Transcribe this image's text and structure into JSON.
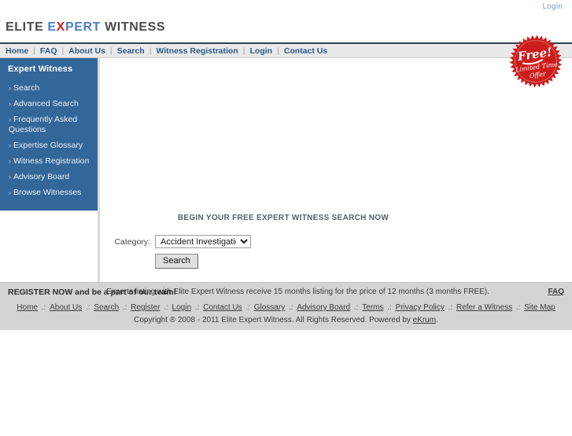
{
  "topbar": {
    "login_label": "Login"
  },
  "logo": {
    "part1": "ELITE ",
    "part2_e": "E",
    "part2_x": "X",
    "part2_pert": "PERT",
    "part3": " WITNESS"
  },
  "badge": {
    "title": "Free!",
    "line1": "Limited Time",
    "line2": "Offer",
    "color": "#cc1d1d"
  },
  "nav": {
    "items": [
      {
        "label": "Home"
      },
      {
        "label": "FAQ"
      },
      {
        "label": "About Us"
      },
      {
        "label": "Search"
      },
      {
        "label": "Witness Registration"
      },
      {
        "label": "Login"
      },
      {
        "label": "Contact Us"
      }
    ],
    "separator": "|"
  },
  "sidebar": {
    "title": "Expert Witness",
    "arrow": "›",
    "background": "#336699",
    "items": [
      {
        "label": "Search"
      },
      {
        "label": "Advanced Search"
      },
      {
        "label": "Frequently Asked Questions"
      },
      {
        "label": "Expertise Glossary"
      },
      {
        "label": "Witness Registration"
      },
      {
        "label": "Advisory Board"
      },
      {
        "label": "Browse Witnesses"
      }
    ]
  },
  "search_form": {
    "heading": "BEGIN YOUR FREE EXPERT WITNESS SEARCH NOW",
    "category_label": "Category:",
    "category_value": "Accident Investigation",
    "category_options": [
      "Accident Investigation"
    ],
    "submit_label": "Search"
  },
  "footer": {
    "register_text": "REGISTER NOW and be a part of our team!",
    "promo_text": "Experts listing with Elite Expert Witness receive 15 months listing for the price of 12 months (3 months FREE).",
    "faq_label": "FAQ",
    "link_separator": ".:",
    "links": [
      {
        "label": "Home"
      },
      {
        "label": "About Us"
      },
      {
        "label": "Search"
      },
      {
        "label": "Register"
      },
      {
        "label": "Login"
      },
      {
        "label": "Contact Us"
      },
      {
        "label": "Glossary"
      },
      {
        "label": "Advisory Board"
      },
      {
        "label": "Terms"
      },
      {
        "label": "Privacy Policy"
      },
      {
        "label": "Refer a Witness"
      },
      {
        "label": "Site Map"
      }
    ],
    "copyright_prefix": "Copyright ® 2008 - 2011 Elite Expert Witness. All Rights Reserved. Powered by ",
    "copyright_vendor": "eKrum",
    "copyright_suffix": "."
  }
}
